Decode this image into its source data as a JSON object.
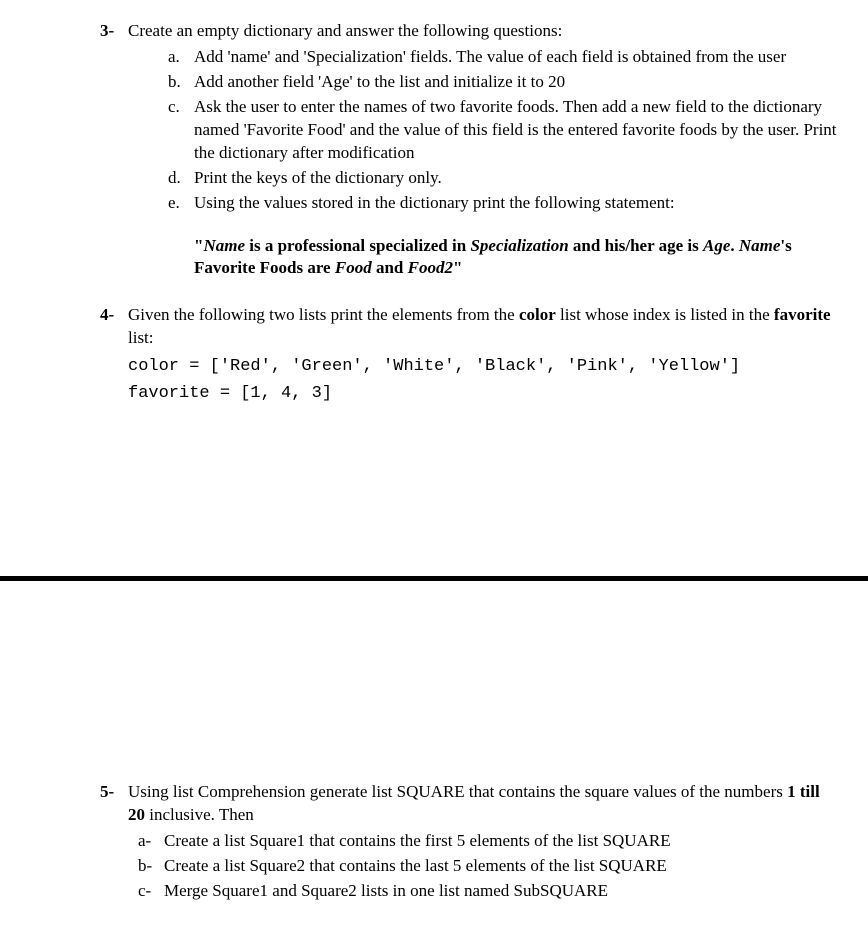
{
  "q3": {
    "num": "3-",
    "intro": "Create an empty dictionary and answer the following questions:",
    "a": {
      "num": "a.",
      "text": "Add 'name' and 'Specialization' fields. The value of each field is obtained from the user"
    },
    "b": {
      "num": "b.",
      "text": "Add another field 'Age' to the list and initialize it to  20"
    },
    "c": {
      "num": "c.",
      "text": "Ask the user to enter the names of two favorite foods. Then add a new field to the dictionary named 'Favorite Food' and the value of this field is the entered favorite foods by the user. Print the dictionary after modification"
    },
    "d": {
      "num": "d.",
      "text": "Print the keys of the dictionary only."
    },
    "e": {
      "num": "e.",
      "text": "Using the values stored in the dictionary print the following statement:"
    },
    "stmt": {
      "p1": "\"",
      "name": "Name",
      "p2": " is a professional specialized in ",
      "spec": "Specialization",
      "p3": " and his/her age is ",
      "age": "Age",
      "p4": ". ",
      "name2": "Name",
      "p5": "'s Favorite Foods are ",
      "food": "Food",
      "p6": " and ",
      "food2": "Food2",
      "p7": "\""
    }
  },
  "q4": {
    "num": "4-",
    "intro_pre": "Given the following two lists print the elements from the ",
    "intro_color": "color",
    "intro_mid": " list whose index is listed in the ",
    "intro_fav": "favorite",
    "intro_end": " list:",
    "code1": "color = ['Red', 'Green', 'White', 'Black', 'Pink', 'Yellow']",
    "code2": "favorite = [1, 4, 3]"
  },
  "q5": {
    "num": "5-",
    "intro_pre": "Using list Comprehension generate list SQUARE that contains the square values of the numbers ",
    "intro_bold": "1 till 20",
    "intro_end": " inclusive. Then",
    "a": {
      "num": "a-",
      "text": "Create a list Square1 that contains the first 5 elements of the list SQUARE"
    },
    "b": {
      "num": "b-",
      "text": "Create a list Square2 that contains the last 5 elements of the list SQUARE"
    },
    "c": {
      "num": "c-",
      "text": "Merge Square1 and Square2 lists in one list named SubSQUARE"
    }
  }
}
